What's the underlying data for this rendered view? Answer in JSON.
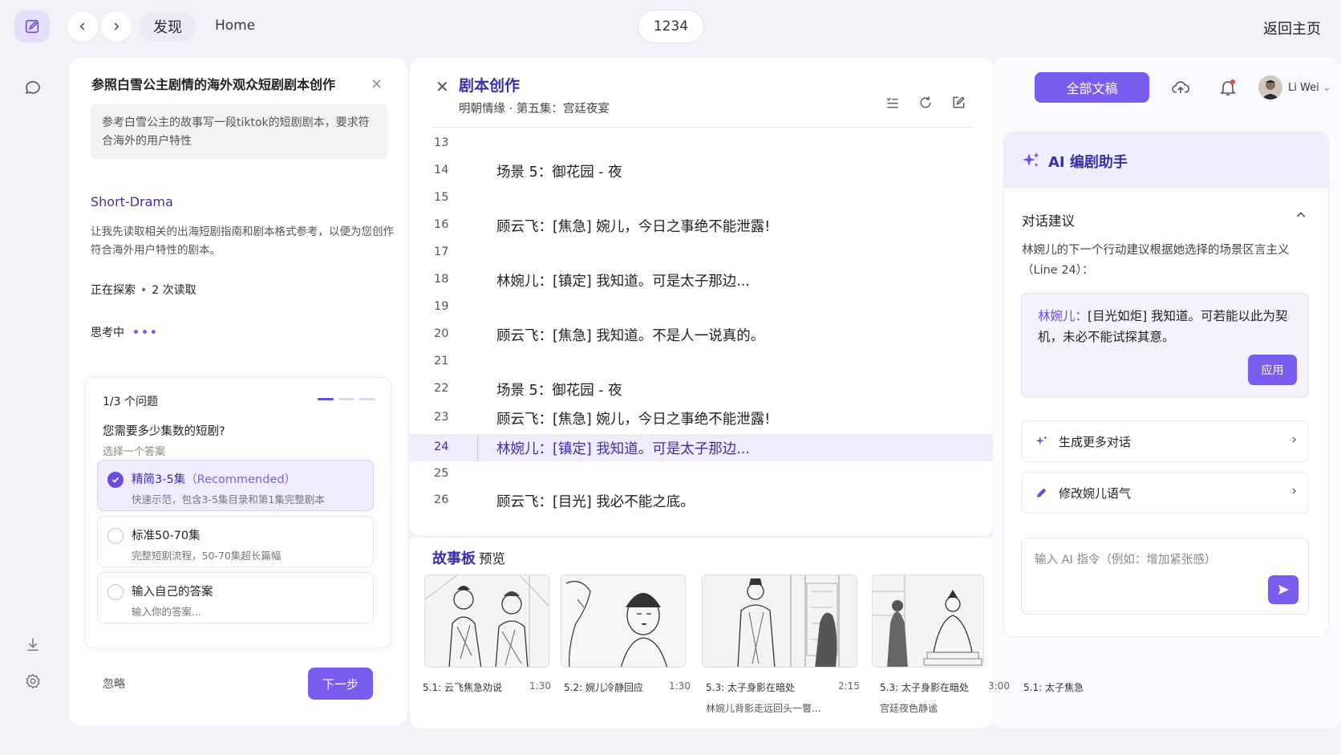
{
  "topbar": {
    "crumb_discover": "发现",
    "crumb_home": "Home",
    "center_label": "1234",
    "back_home": "返回主页"
  },
  "left_panel": {
    "title": "参照白雪公主剧情的海外观众短剧剧本创作",
    "prompt": "参考白雪公主的故事写一段tiktok的短剧剧本，要求符合海外的用户特性",
    "agent_name": "Short-Drama",
    "agent_desc": "让我先读取相关的出海短剧指南和剧本格式参考，以便为您创作符合海外用户特性的剧本。",
    "explore_label": "正在探索",
    "explore_count": "2 次读取",
    "thinking_label": "思考中",
    "question": {
      "progress": "1/3 个问题",
      "text": "您需要多少集数的短剧?",
      "hint": "选择一个答案",
      "options": [
        {
          "title": "精简3-5集",
          "tag": "（Recommended）",
          "sub": "快速示范，包含3-5集目录和第1集完整剧本"
        },
        {
          "title": "标准50-70集",
          "tag": "",
          "sub": "完整短剧流程，50-70集超长篇幅"
        },
        {
          "title": "输入自己的答案",
          "tag": "",
          "sub": "输入你的答案..."
        }
      ],
      "ignore": "忽略",
      "next": "下一步"
    }
  },
  "editor": {
    "title": "剧本创作",
    "subtitle": "明朝情缘 · 第五集：宫廷夜宴",
    "lines": [
      {
        "n": "13",
        "t": ""
      },
      {
        "n": "14",
        "t": "场景 5：御花园 - 夜"
      },
      {
        "n": "15",
        "t": ""
      },
      {
        "n": "16",
        "t": "顾云飞：[焦急] 婉儿，今日之事绝不能泄露!"
      },
      {
        "n": "17",
        "t": ""
      },
      {
        "n": "18",
        "t": "林婉儿：[镇定] 我知道。可是太子那边..."
      },
      {
        "n": "19",
        "t": ""
      },
      {
        "n": "20",
        "t": "顾云飞：[焦急] 我知道。不是人一说真的。"
      },
      {
        "n": "21",
        "t": ""
      },
      {
        "n": "22",
        "t": "场景 5：御花园 - 夜"
      },
      {
        "n": "23",
        "t": "顾云飞：[焦急] 婉儿，今日之事绝不能泄露!"
      },
      {
        "n": "24",
        "t": "林婉儿：[镇定] 我知道。可是太子那边..."
      },
      {
        "n": "25",
        "t": ""
      },
      {
        "n": "26",
        "t": "顾云飞：[目光] 我必不能之底。"
      }
    ]
  },
  "storyboard": {
    "title": "故事板",
    "suffix": "预览",
    "frames": [
      {
        "caption": "5.1: 云飞焦急劝说",
        "duration": "1:30",
        "note": ""
      },
      {
        "caption": "5.2: 婉儿冷静回应",
        "duration": "1:30",
        "note": ""
      },
      {
        "caption": "5.3: 太子身影在暗处",
        "duration": "2:15",
        "note": "林婉儿背影走远回头一瞥..."
      },
      {
        "caption": "5.3: 太子身影在暗处",
        "duration": "3:00",
        "note": "宫廷夜色静谧"
      },
      {
        "caption": "5.1: 太子焦急",
        "duration": "",
        "note": ""
      }
    ]
  },
  "right_panel": {
    "all_docs": "全部文稿",
    "username": "Li Wei",
    "assistant_title": "AI 编剧助手",
    "section_title": "对话建议",
    "section_desc": "林婉儿的下一个行动建议根据她选择的场景区言主义（Line 24）：",
    "suggestion_who": "林婉儿：",
    "suggestion_text": "[目光如炬] 我知道。可若能以此为契机，未必不能试探其意。",
    "apply": "应用",
    "actions": [
      {
        "label": "生成更多对话",
        "icon": "sparkle-icon"
      },
      {
        "label": "修改婉儿语气",
        "icon": "pencil-icon"
      }
    ],
    "input_placeholder": "输入 AI 指令（例如：增加紧张感）"
  },
  "colors": {
    "accent": "#7a5df0",
    "accent_dark": "#3b2fb0",
    "highlight_row": "#efecfb"
  }
}
